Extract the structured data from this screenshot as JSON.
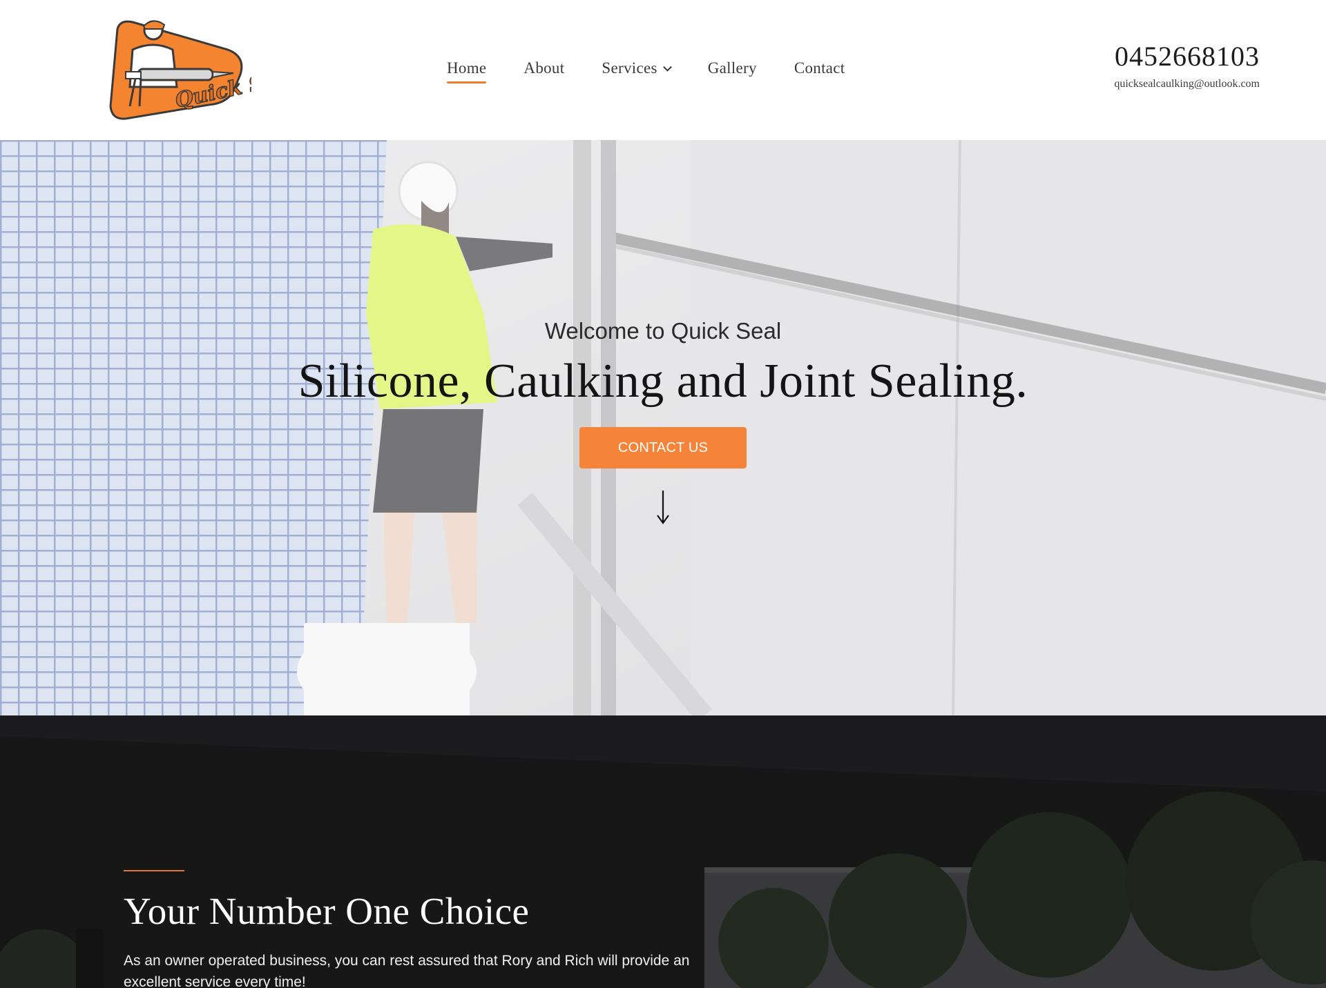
{
  "header": {
    "logo_text": "Quick Seal",
    "nav": [
      {
        "label": "Home",
        "active": true
      },
      {
        "label": "About"
      },
      {
        "label": "Services",
        "has_dropdown": true
      },
      {
        "label": "Gallery"
      },
      {
        "label": "Contact"
      }
    ],
    "phone": "0452668103",
    "email": "quicksealcaulking@outlook.com"
  },
  "hero": {
    "welcome": "Welcome to Quick Seal",
    "headline": "Silicone, Caulking and Joint Sealing.",
    "cta_label": "CONTACT US",
    "scroll_icon": "arrow-down-icon"
  },
  "about": {
    "title": "Your Number One Choice",
    "text": "As an owner operated business, you can rest assured that  Rory and Rich will provide an excellent service every time!"
  },
  "colors": {
    "accent": "#f47b2a",
    "button": "#f5833a",
    "dark_section": "#222222"
  }
}
